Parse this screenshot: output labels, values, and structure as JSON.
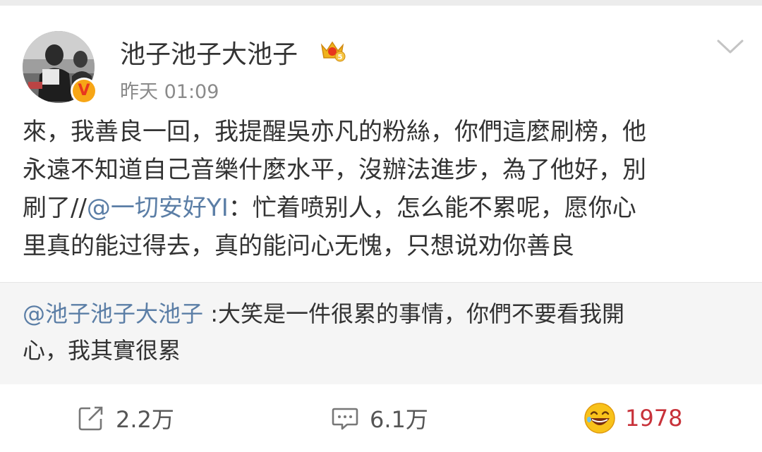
{
  "post": {
    "username": "池子池子大池子",
    "timestamp": "昨天 01:09",
    "text_lines": [
      "來，我善良一回，我提醒吳亦凡的粉絲，你們這麼刷榜，他",
      "永遠不知道自己音樂什麼水平，沒辦法進步，為了他好，別"
    ],
    "line3_prefix": "刷了//",
    "line3_mention": "@一切安好YI",
    "line3_rest": "：忙着喷别人，怎么能不累呢，愿你心",
    "line4": "里真的能过得去，真的能问心无愧，只想说劝你善良",
    "verified_mark": "V",
    "icons": {
      "membership_badge": "crown-vip-icon",
      "menu": "chevron-down-icon",
      "verified": "verified-v-icon"
    }
  },
  "retweet": {
    "mention": "@池子池子大池子",
    "text_line1": " :大笑是一件很累的事情，你們不要看我開",
    "text_line2": "心，我其實很累"
  },
  "actions": {
    "repost_count": "2.2万",
    "comment_count": "6.1万",
    "like_count": "1978",
    "icons": {
      "repost": "share-icon",
      "comment": "comment-icon",
      "like": "laughing-emoji-icon"
    }
  },
  "colors": {
    "mention": "#5b7ea6",
    "like_count": "#c8323a",
    "retweet_bg": "#f5f5f5"
  }
}
